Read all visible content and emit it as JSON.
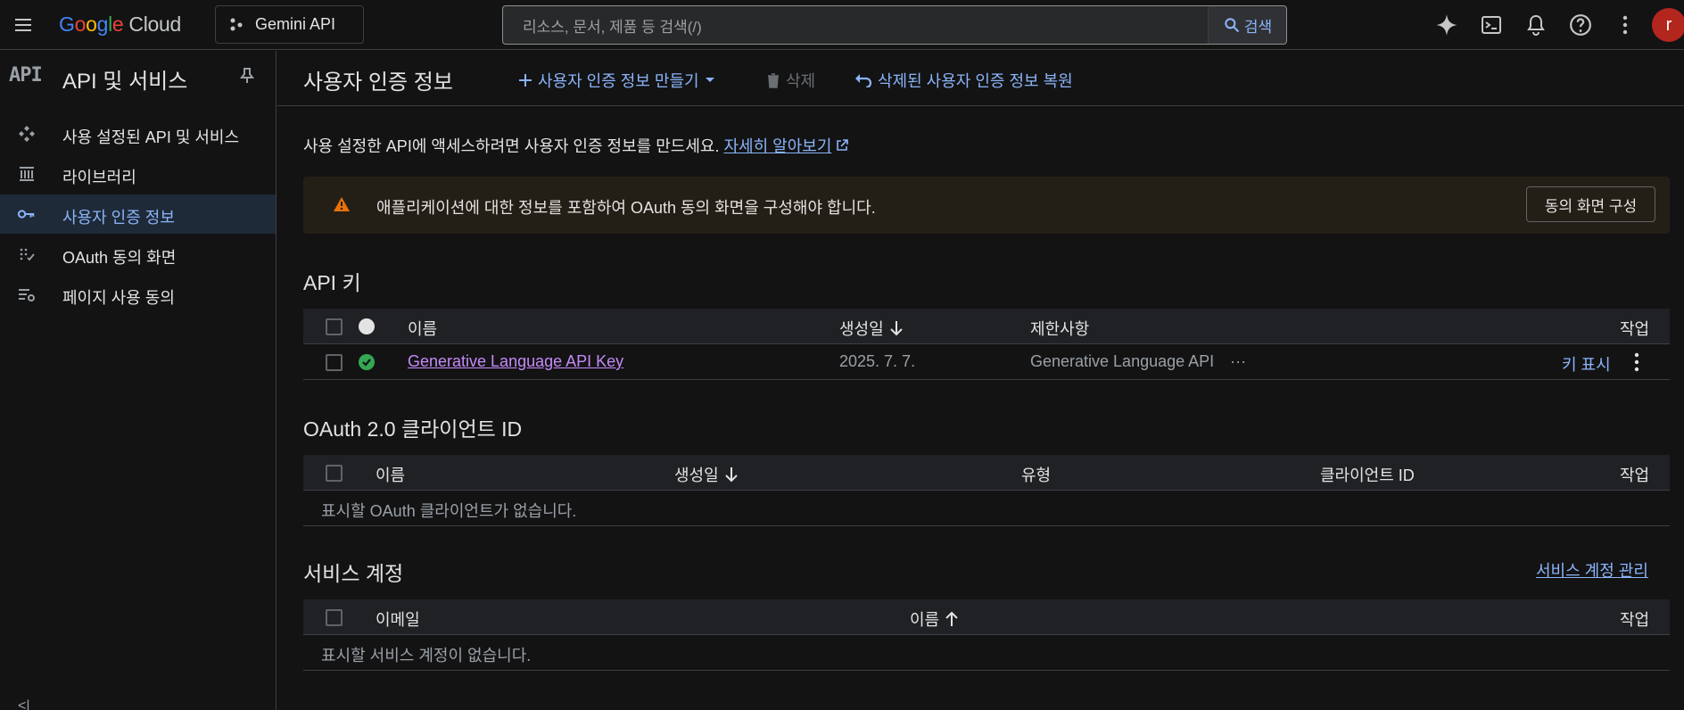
{
  "topbar": {
    "logo_letters": [
      "G",
      "o",
      "o",
      "g",
      "l",
      "e"
    ],
    "logo_suffix": "Cloud",
    "project": "Gemini API",
    "search_placeholder": "리소스, 문서, 제품 등 검색(/)",
    "search_button": "검색",
    "avatar_letter": "r",
    "colors": {
      "accent": "#8ab4f8",
      "avatar": "#b3261e"
    }
  },
  "sidebar": {
    "badge": "API",
    "title": "API 및 서비스",
    "items": [
      {
        "label": "사용 설정된 API 및 서비스",
        "icon": "api-hub-icon"
      },
      {
        "label": "라이브러리",
        "icon": "library-icon"
      },
      {
        "label": "사용자 인증 정보",
        "icon": "key-icon",
        "active": true
      },
      {
        "label": "OAuth 동의 화면",
        "icon": "oauth-consent-icon"
      },
      {
        "label": "페이지 사용 동의",
        "icon": "page-usage-icon"
      }
    ],
    "collapse": "<|"
  },
  "main": {
    "title": "사용자 인증 정보",
    "actions": {
      "create": "사용자 인증 정보 만들기",
      "delete": "삭제",
      "restore": "삭제된 사용자 인증 정보 복원"
    },
    "intro": "사용 설정한 API에 액세스하려면 사용자 인증 정보를 만드세요.",
    "learn_more": "자세히 알아보기",
    "warning": {
      "text": "애플리케이션에 대한 정보를 포함하여 OAuth 동의 화면을 구성해야 합니다.",
      "button": "동의 화면 구성"
    },
    "api_keys": {
      "title": "API 키",
      "columns": [
        "이름",
        "생성일",
        "제한사항",
        "작업"
      ],
      "rows": [
        {
          "name": "Generative Language API Key",
          "created": "2025. 7. 7.",
          "restriction": "Generative Language API",
          "more": "···",
          "show_key": "키 표시",
          "status": "ok"
        }
      ]
    },
    "oauth": {
      "title": "OAuth 2.0 클라이언트 ID",
      "columns": [
        "이름",
        "생성일",
        "유형",
        "클라이언트 ID",
        "작업"
      ],
      "empty": "표시할 OAuth 클라이언트가 없습니다."
    },
    "service_accounts": {
      "title": "서비스 계정",
      "manage": "서비스 계정 관리",
      "columns": [
        "이메일",
        "이름",
        "작업"
      ],
      "empty": "표시할 서비스 계정이 없습니다."
    }
  }
}
